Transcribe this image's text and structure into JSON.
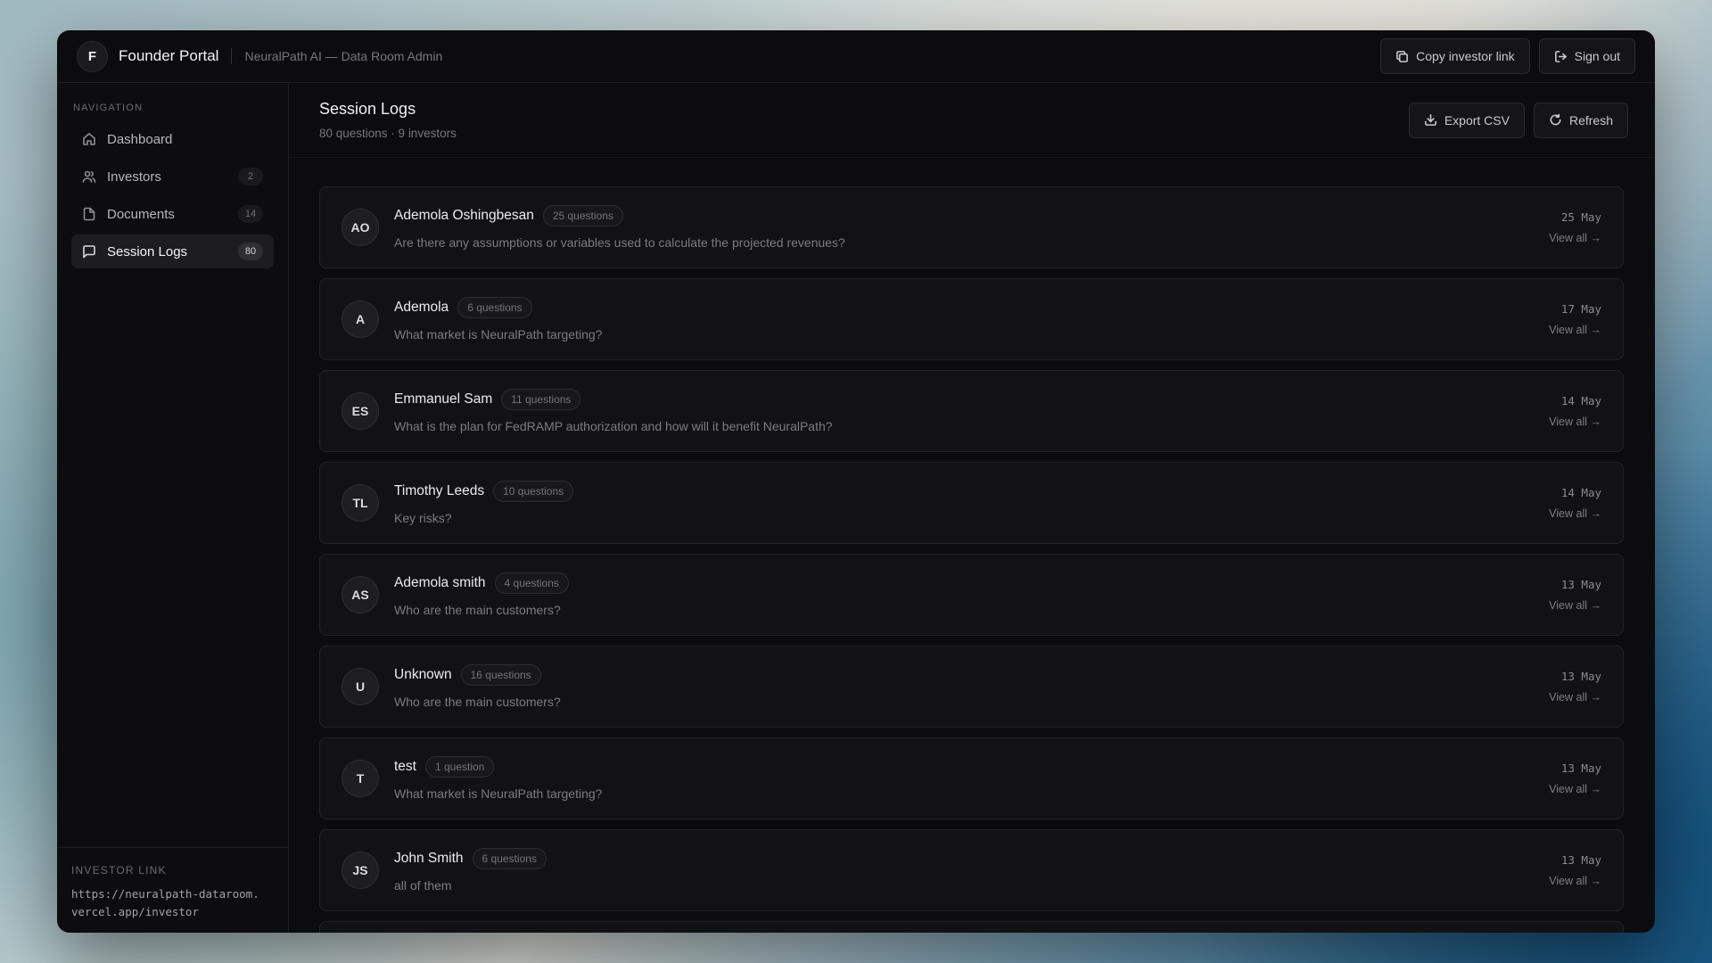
{
  "topbar": {
    "avatar_letter": "F",
    "title": "Founder Portal",
    "subtitle": "NeuralPath AI — Data Room Admin",
    "copy_link_label": "Copy investor link",
    "sign_out_label": "Sign out"
  },
  "sidebar": {
    "heading": "NAVIGATION",
    "items": [
      {
        "label": "Dashboard",
        "icon": "home-icon",
        "badge": ""
      },
      {
        "label": "Investors",
        "icon": "users-icon",
        "badge": "2"
      },
      {
        "label": "Documents",
        "icon": "file-icon",
        "badge": "14"
      },
      {
        "label": "Session Logs",
        "icon": "message-icon",
        "badge": "80",
        "active": true
      }
    ],
    "footer_heading": "INVESTOR LINK",
    "footer_link_line1": "https://neuralpath-dataroom.",
    "footer_link_line2": "vercel.app/investor"
  },
  "main": {
    "title": "Session Logs",
    "subtitle": "80 questions · 9 investors",
    "export_label": "Export CSV",
    "refresh_label": "Refresh"
  },
  "sessions": [
    {
      "initials": "AO",
      "name": "Ademola Oshingbesan",
      "count": "25 questions",
      "question": "Are there any assumptions or variables used to calculate the projected revenues?",
      "date": "25 May",
      "view": "View all →"
    },
    {
      "initials": "A",
      "name": "Ademola",
      "count": "6 questions",
      "question": "What market is NeuralPath targeting?",
      "date": "17 May",
      "view": "View all →"
    },
    {
      "initials": "ES",
      "name": "Emmanuel Sam",
      "count": "11 questions",
      "question": "What is the plan for FedRAMP authorization and how will it benefit NeuralPath?",
      "date": "14 May",
      "view": "View all →"
    },
    {
      "initials": "TL",
      "name": "Timothy Leeds",
      "count": "10 questions",
      "question": "Key risks?",
      "date": "14 May",
      "view": "View all →"
    },
    {
      "initials": "AS",
      "name": "Ademola smith",
      "count": "4 questions",
      "question": "Who are the main customers?",
      "date": "13 May",
      "view": "View all →"
    },
    {
      "initials": "U",
      "name": "Unknown",
      "count": "16 questions",
      "question": "Who are the main customers?",
      "date": "13 May",
      "view": "View all →"
    },
    {
      "initials": "T",
      "name": "test",
      "count": "1 question",
      "question": "What market is NeuralPath targeting?",
      "date": "13 May",
      "view": "View all →"
    },
    {
      "initials": "JS",
      "name": "John Smith",
      "count": "6 questions",
      "question": "all of them",
      "date": "13 May",
      "view": "View all →"
    }
  ]
}
